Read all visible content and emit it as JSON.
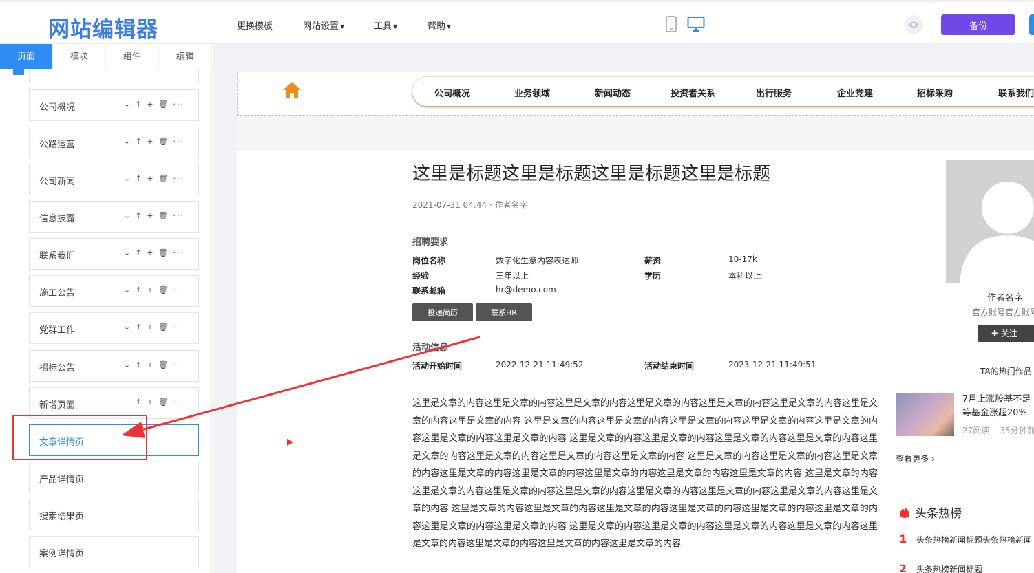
{
  "app": {
    "logo": "网站编辑器",
    "menu": [
      "更换模板",
      "网站设置",
      "工具",
      "帮助"
    ],
    "backup_label": "备份"
  },
  "sidebar": {
    "tabs": [
      "页面",
      "模块",
      "组件",
      "编辑"
    ],
    "action_icons": "↓ ↑ + 🗑 ···",
    "action_icons_short": "↑ + 🗑 ···",
    "pages": [
      "公司概况",
      "公路运营",
      "公司新闻",
      "信息披露",
      "联系我们",
      "施工公告",
      "党群工作",
      "招标公告",
      "新增页面",
      "文章详情页",
      "产品详情页",
      "搜索结果页",
      "案例详情页"
    ],
    "active_page": "文章详情页"
  },
  "site": {
    "nav": [
      "公司概况",
      "业务领域",
      "新闻动态",
      "投资者关系",
      "出行服务",
      "企业党建",
      "招标采购",
      "联系我们"
    ],
    "article": {
      "title": "这里是标题这里是标题这里是标题这里是标题",
      "meta": "2021-07-31 04:44 · 作者名字",
      "recruit": {
        "section": "招聘要求",
        "job_key": "岗位名称",
        "job_val": "数字化生意内容表达师",
        "salary_key": "薪资",
        "salary_val": "10-17k",
        "exp_key": "经验",
        "exp_val": "三年以上",
        "edu_key": "学历",
        "edu_val": "本科以上",
        "email_key": "联系邮箱",
        "email_val": "hr@demo.com",
        "btn_resume": "投递简历",
        "btn_hr": "联系HR"
      },
      "activity": {
        "section": "活动信息",
        "start_key": "活动开始时间",
        "start_val": "2022-12-21 11:49:52",
        "end_key": "活动结束时间",
        "end_val": "2023-12-21 11:49:51"
      },
      "body": "这里是文章的内容这里是文章的内容这里是文章的内容这里是文章的内容这里是文章的内容这里是文章的内容这里是文章的内容这里是文章的内容 这里是文章的内容这里是文章的内容这里是文章的内容这里是文章的内容这里是文章的内容这里是文章的内容这里是文章的内容 这里是文章的内容这里是文章的内容这里是文章的内容这里是文章的内容这里是文章的内容这里是文章的内容这里是文章的内容这里是文章的内容 这里是文章的内容这里是文章的内容这里是文章的内容这里是文章的内容这里是文章的内容这里是文章的内容这里是文章的内容这里是文章的内容 这里是文章的内容这里是文章的内容这里是文章的内容这里是文章的内容这里是文章的内容这里是文章的内容这里是文章的内容这里是文章的内容 这里是文章的内容这里是文章的内容这里是文章的内容这里是文章的内容这里是文章的内容这里是文章的内容这里是文章的内容这里是文章的内容 这里是文章的内容这里是文章的内容这里是文章的内容这里是文章的内容这里是文章的内容这里是文章的内容这里是文章的内容这里是文章的内容"
    },
    "author": {
      "name": "作者名字",
      "desc": "官方账号官方账号",
      "follow_label": "✚ 关注",
      "hot_works_label": "TA的热门作品",
      "work_title_1": "7月上涨股基不足",
      "work_title_2": "等基金涨超20%",
      "work_reads": "27阅读",
      "work_time": "35分钟前",
      "more_label": "查看更多 ›"
    },
    "hot_list": {
      "title": "头条热榜",
      "items": [
        {
          "rank": "1",
          "text": "头条热榜新闻标题头条热榜新闻"
        },
        {
          "rank": "2",
          "text": "头条热榜新闻标题"
        }
      ]
    }
  },
  "colors": {
    "accent": "#2f8cf0",
    "backup": "#7247e8",
    "highlight": "#e33333",
    "home_icon": "#f08c1a"
  }
}
